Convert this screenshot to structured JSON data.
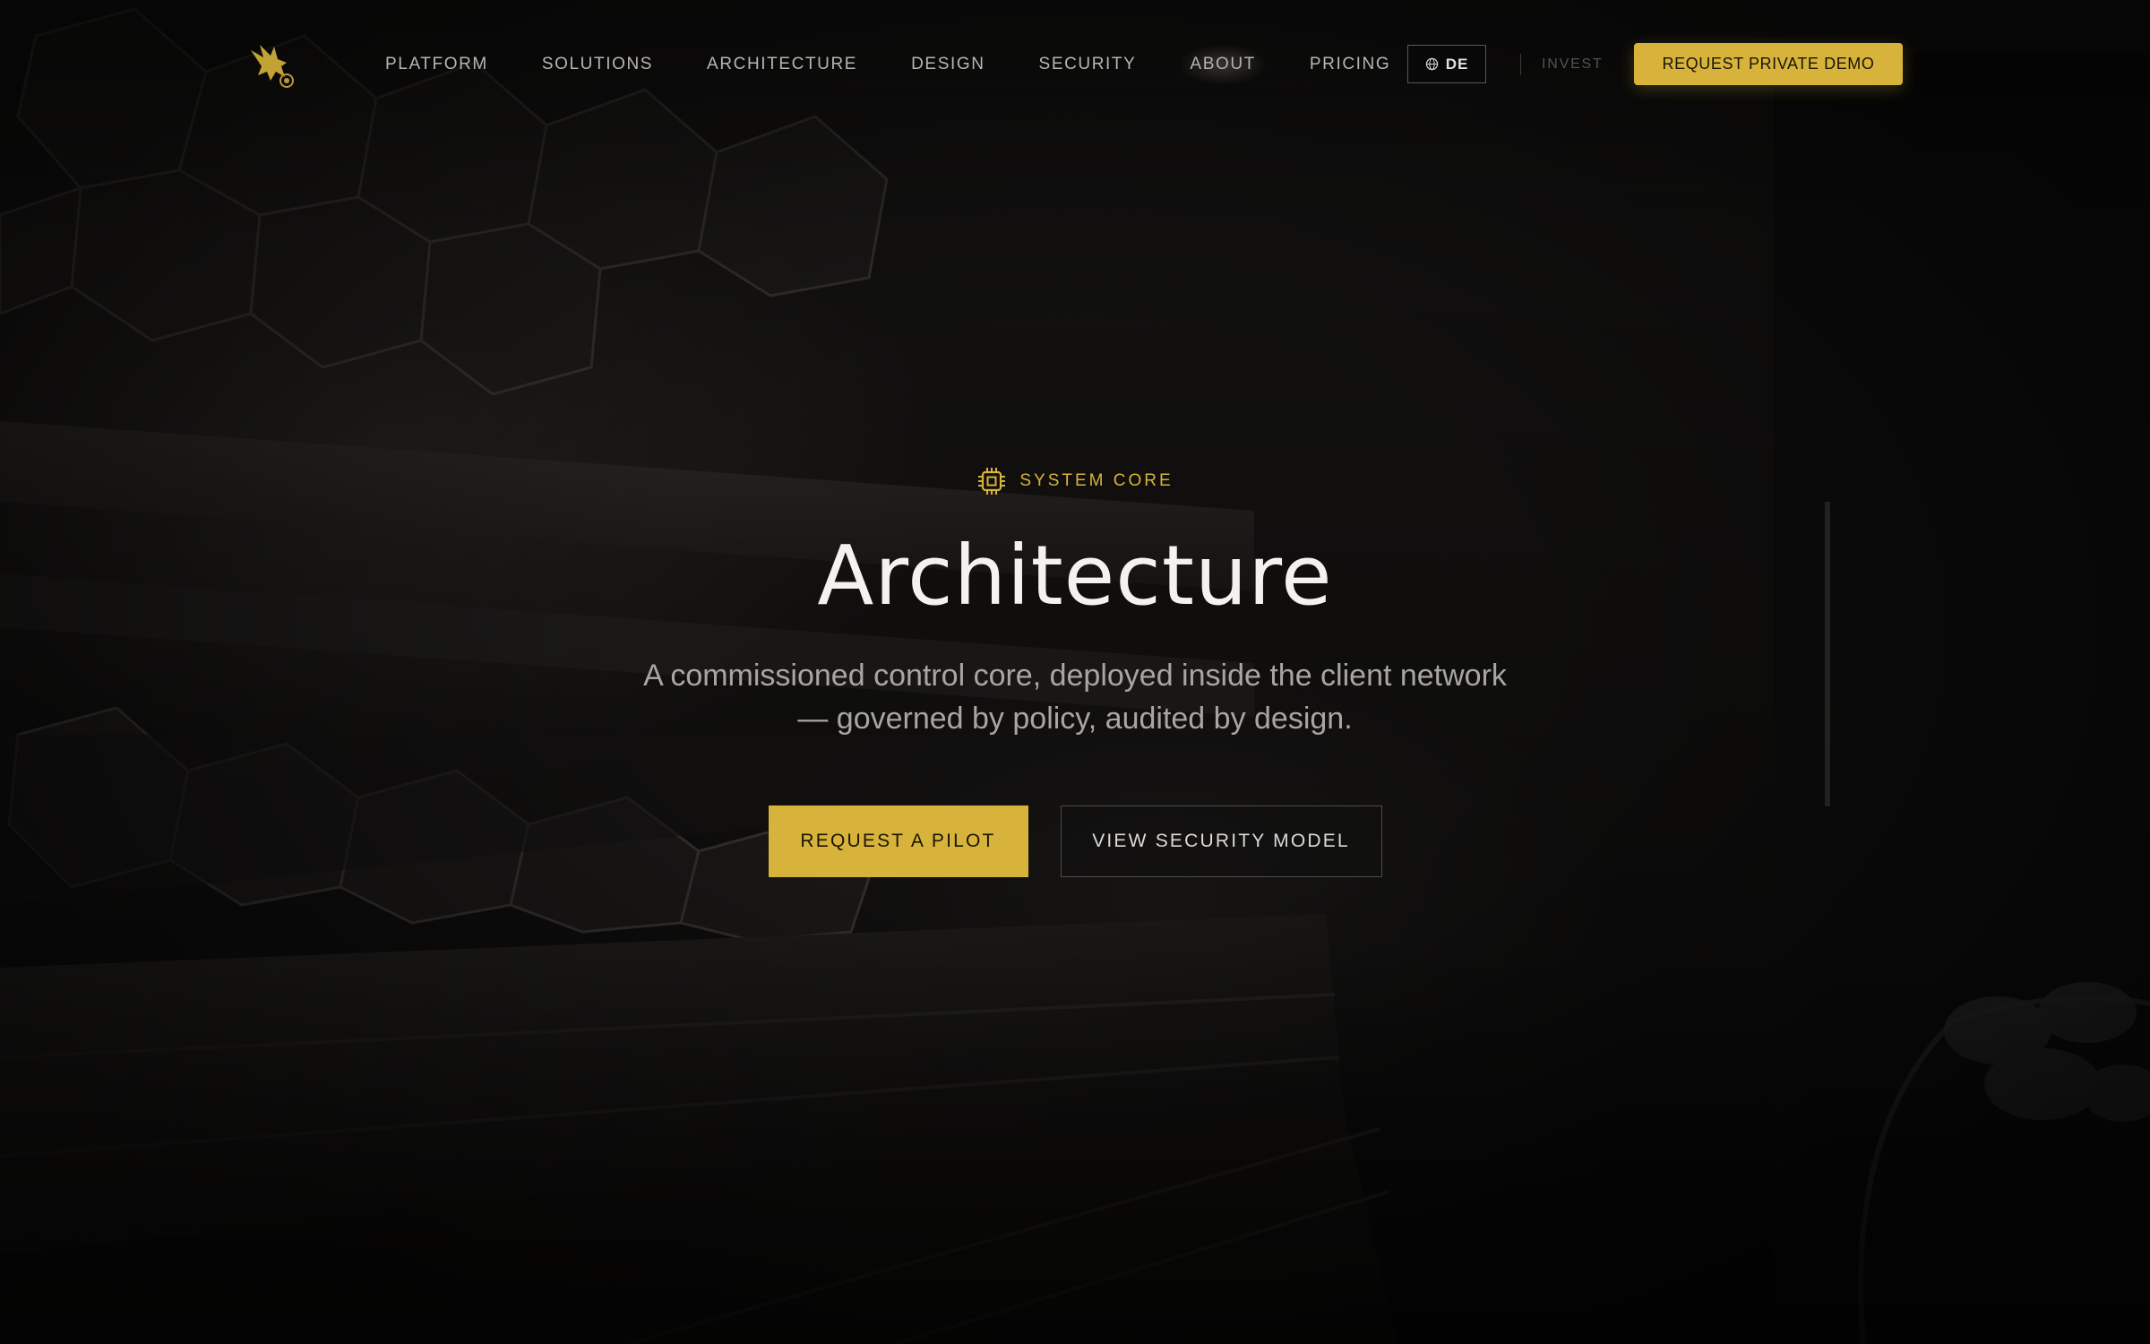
{
  "nav": {
    "logo_icon": "griffin-logo-icon",
    "links": [
      {
        "label": "PLATFORM"
      },
      {
        "label": "SOLUTIONS"
      },
      {
        "label": "ARCHITECTURE"
      },
      {
        "label": "DESIGN"
      },
      {
        "label": "SECURITY"
      },
      {
        "label": "ABOUT",
        "active": true
      },
      {
        "label": "PRICING"
      }
    ],
    "language": {
      "icon": "globe-icon",
      "label": "DE"
    },
    "invest_label": "INVEST",
    "demo_button_label": "REQUEST PRIVATE DEMO"
  },
  "hero": {
    "eyebrow_icon": "chip-icon",
    "eyebrow": "SYSTEM CORE",
    "title": "Architecture",
    "subtitle_line1": "A commissioned control core, deployed inside the client network",
    "subtitle_line2": "— governed by policy, audited by design.",
    "primary_cta": "REQUEST A PILOT",
    "secondary_cta": "VIEW SECURITY MODEL"
  },
  "colors": {
    "accent": "#d7b33b",
    "background": "#0b0b0b",
    "text": "#f4f2ee",
    "muted": "#a9a6a0"
  }
}
